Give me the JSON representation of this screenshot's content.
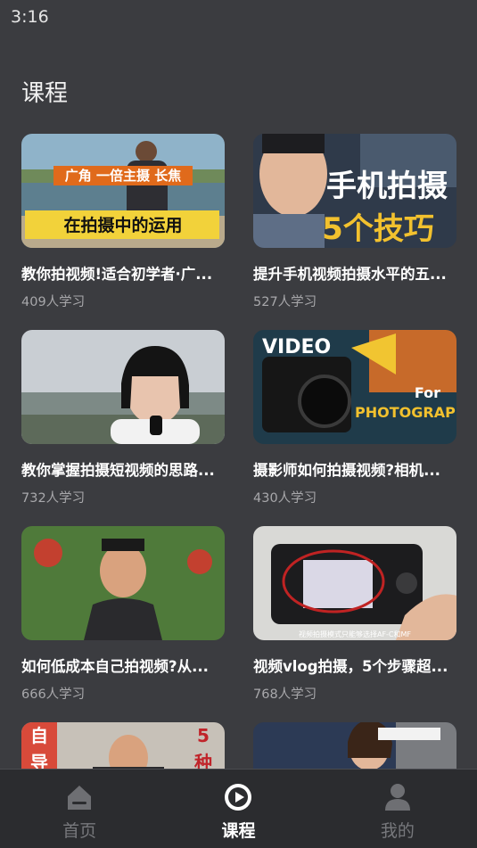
{
  "status": {
    "time": "3:16"
  },
  "page": {
    "title": "课程"
  },
  "courses": [
    {
      "title": "教你拍视频!适合初学者·广...",
      "learners": "409人学习",
      "overlay": [
        "广角 一倍主摄 长焦",
        "在拍摄中的运用"
      ]
    },
    {
      "title": "提升手机视频拍摄水平的五...",
      "learners": "527人学习",
      "overlay": [
        "手机拍摄",
        "5个技巧"
      ]
    },
    {
      "title": "教你掌握拍摄短视频的思路...",
      "learners": "732人学习",
      "overlay": []
    },
    {
      "title": "摄影师如何拍摄视频?相机...",
      "learners": "430人学习",
      "overlay": [
        "VIDEO",
        "For",
        "PHOTOGRAPHERS"
      ]
    },
    {
      "title": "如何低成本自己拍视频?从...",
      "learners": "666人学习",
      "overlay": []
    },
    {
      "title": "视频vlog拍摄，5个步骤超...",
      "learners": "768人学习",
      "overlay": [
        "视频拍摄模式只能够选择AF-C和MF"
      ]
    },
    {
      "title": "",
      "learners": "",
      "overlay": [
        "自",
        "导",
        "5",
        "种"
      ]
    },
    {
      "title": "",
      "learners": "",
      "overlay": []
    }
  ],
  "tabs": [
    {
      "label": "首页",
      "icon": "home-icon",
      "active": false
    },
    {
      "label": "课程",
      "icon": "play-circle-icon",
      "active": true
    },
    {
      "label": "我的",
      "icon": "user-icon",
      "active": false
    }
  ],
  "colors": {
    "background": "#3b3c40",
    "tab_bar": "#2b2c2f",
    "inactive": "#77787c",
    "active": "#ffffff"
  }
}
